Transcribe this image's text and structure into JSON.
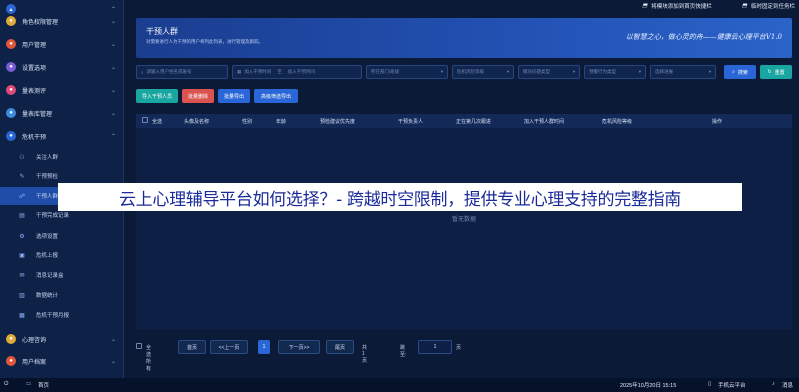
{
  "sidebar": {
    "items": [
      {
        "label": "",
        "icon": "chevron-up-icon",
        "color": "#2a66d8"
      },
      {
        "label": "角色权限管理",
        "icon": "role-icon",
        "color": "#e0a93a"
      },
      {
        "label": "用户管理",
        "icon": "user-icon",
        "color": "#e0563a"
      },
      {
        "label": "设置选项",
        "icon": "settings-icon",
        "color": "#7a5cd6"
      },
      {
        "label": "量表测评",
        "icon": "scale-icon",
        "color": "#e04a7a"
      },
      {
        "label": "量表库管理",
        "icon": "library-icon",
        "color": "#3a8be0"
      },
      {
        "label": "危机干预",
        "icon": "crisis-icon",
        "color": "#2a66d8"
      }
    ],
    "sub_items": [
      {
        "label": "关注人群",
        "icon": "people-icon"
      },
      {
        "label": "干预预检",
        "icon": "check-icon"
      },
      {
        "label": "干预人群",
        "icon": "intervene-icon",
        "active": true
      },
      {
        "label": "干预完成记录",
        "icon": "record-icon"
      },
      {
        "label": "选项设置",
        "icon": "option-icon"
      },
      {
        "label": "危机上报",
        "icon": "report-icon"
      },
      {
        "label": "消息记录盒",
        "icon": "message-icon"
      },
      {
        "label": "数据统计",
        "icon": "stats-icon"
      },
      {
        "label": "危机干预月报",
        "icon": "monthly-icon"
      }
    ],
    "bottom_items": [
      {
        "label": "心理咨询",
        "icon": "consult-icon",
        "color": "#e0a93a"
      },
      {
        "label": "用户档案",
        "icon": "archive-icon",
        "color": "#e0563a"
      }
    ]
  },
  "top_buttons": {
    "add_shortcut": "将模块添加到首页快捷栏",
    "temp_task": "临时固定到任务栏"
  },
  "banner": {
    "title": "干预人群",
    "desc": "对需要进行人为干预的用户将列此列表，进行管理及跟踪。",
    "slogan": "以智慧之心，做心灵的舟——健康云心理平台V1.0"
  },
  "filters": {
    "search_placeholder": "请输入用户姓名或账号",
    "date_start": "加入干预时间",
    "date_sep": "至",
    "date_end": "加入干预时间",
    "dept": "所在部门/班级",
    "risk": "危机风险等级",
    "source": "模块问题类型",
    "status": "预警行为类型",
    "sort": "选择进展",
    "search_btn": "搜索",
    "reset_btn": "重置"
  },
  "actions": {
    "import": "导入干预人员",
    "batch_delete": "批量删除",
    "batch_export": "批量导出",
    "advanced_export": "高级筛选导出",
    "colors": {
      "import": "#19a5a0",
      "batch_delete": "#d9534f",
      "batch_export": "#2a66d8",
      "advanced_export": "#2a66d8"
    }
  },
  "table": {
    "headers": [
      "全选",
      "头像及名称",
      "性别",
      "年龄",
      "预检建议优先度",
      "干预负责人",
      "正在第几次跟进",
      "加入干预人群时间",
      "危机风险等级",
      "操作"
    ],
    "empty_text": "暂无数据"
  },
  "pager": {
    "select_all": "全选所有",
    "first": "首页",
    "prev": "<<上一页",
    "current": "1",
    "next": "下一页>>",
    "last": "尾页",
    "total": "共1页",
    "jump_label": "跳至:",
    "jump_value": "1",
    "page_unit": "页"
  },
  "taskbar": {
    "home": "首页",
    "datetime": "2025年10月20日 15:15",
    "mobile": "手机云平台",
    "messages": "消息"
  },
  "overlay_headline": "云上心理辅导平台如何选择？- 跨越时空限制，提供专业心理支持的完整指南"
}
